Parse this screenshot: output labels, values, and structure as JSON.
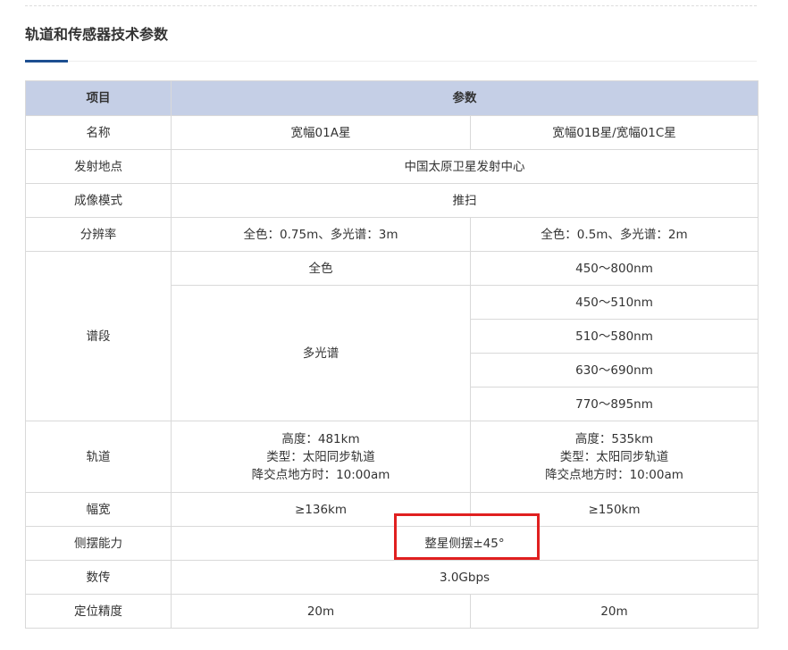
{
  "section": {
    "title": "轨道和传感器技术参数"
  },
  "colors": {
    "header_bg": "#c5cfe6",
    "accent": "#1d4f91",
    "highlight_border": "#e02020",
    "border": "#d9d9d9"
  },
  "table": {
    "header": {
      "item": "项目",
      "params": "参数"
    },
    "rows": {
      "name": {
        "label": "名称",
        "a": "宽幅01A星",
        "b": "宽幅01B星/宽幅01C星"
      },
      "launch_site": {
        "label": "发射地点",
        "value": "中国太原卫星发射中心"
      },
      "imaging_mode": {
        "label": "成像模式",
        "value": "推扫"
      },
      "resolution": {
        "label": "分辨率",
        "a": "全色：0.75m、多光谱：3m",
        "b": "全色：0.5m、多光谱：2m"
      },
      "bands": {
        "label": "谱段",
        "pan_label": "全色",
        "ms_label": "多光谱",
        "pan_b": "450～800nm",
        "ms_b": [
          "450～510nm",
          "510～580nm",
          "630～690nm",
          "770～895nm"
        ]
      },
      "orbit": {
        "label": "轨道",
        "a": [
          "高度：481km",
          "类型：太阳同步轨道",
          "降交点地方时：10:00am"
        ],
        "b": [
          "高度：535km",
          "类型：太阳同步轨道",
          "降交点地方时：10:00am"
        ]
      },
      "swath": {
        "label": "幅宽",
        "a": "≥136km",
        "b": "≥150km"
      },
      "side_swing": {
        "label": "侧摆能力",
        "value": "整星侧摆±45°"
      },
      "data_transmission": {
        "label": "数传",
        "value": "3.0Gbps"
      },
      "positioning_accuracy": {
        "label": "定位精度",
        "a": "20m",
        "b": "20m"
      }
    }
  }
}
